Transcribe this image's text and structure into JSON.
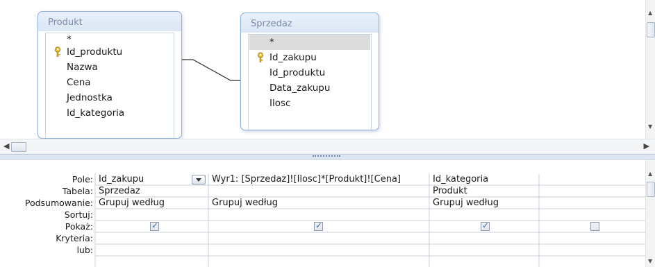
{
  "tables": [
    {
      "title": "Produkt",
      "fields": [
        "*",
        "Id_produktu",
        "Nazwa",
        "Cena",
        "Jednostka",
        "Id_kategoria"
      ],
      "primary_key": "Id_produktu"
    },
    {
      "title": "Sprzedaz",
      "fields": [
        "*",
        "Id_zakupu",
        "Id_produktu",
        "Data_zakupu",
        "Ilosc"
      ],
      "primary_key": "Id_zakupu"
    }
  ],
  "grid": {
    "row_labels": [
      "Pole:",
      "Tabela:",
      "Podsumowanie:",
      "Sortuj:",
      "Pokaż:",
      "Kryteria:",
      "lub:"
    ],
    "columns": [
      {
        "pole": "Id_zakupu",
        "tabela": "Sprzedaz",
        "podsumowanie": "Grupuj według",
        "sortuj": "",
        "pokaz": true,
        "has_dropdown": true
      },
      {
        "pole": "Wyr1: [Sprzedaz]![Ilosc]*[Produkt]![Cena]",
        "tabela": "",
        "podsumowanie": "Grupuj według",
        "sortuj": "",
        "pokaz": true,
        "has_dropdown": false
      },
      {
        "pole": "Id_kategoria",
        "tabela": "Produkt",
        "podsumowanie": "Grupuj według",
        "sortuj": "",
        "pokaz": true,
        "has_dropdown": false
      },
      {
        "pole": "",
        "tabela": "",
        "podsumowanie": "",
        "sortuj": "",
        "pokaz": false,
        "has_dropdown": false
      }
    ]
  },
  "icons": {
    "key": "key-icon",
    "check": "✓"
  },
  "colors": {
    "table_border": "#8fb0d6",
    "title_text": "#7a8aa8",
    "check": "#3f6fb4",
    "selected_row": "#dcdcdc"
  }
}
